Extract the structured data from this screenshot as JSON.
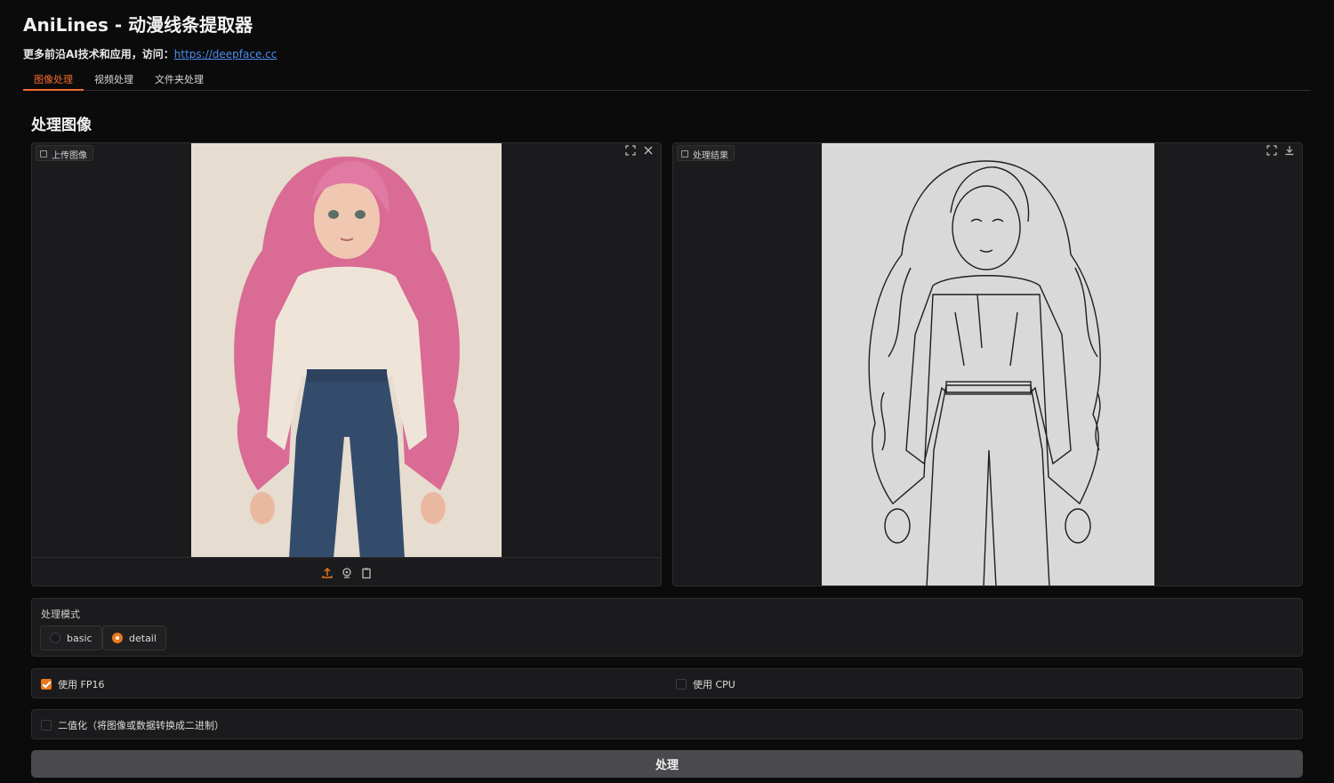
{
  "app": {
    "title": "AniLines - 动漫线条提取器",
    "subtitle_prefix": "更多前沿AI技术和应用，访问：",
    "subtitle_link": "https://deepface.cc"
  },
  "tabs": [
    {
      "label": "图像处理",
      "active": true
    },
    {
      "label": "视频处理",
      "active": false
    },
    {
      "label": "文件夹处理",
      "active": false
    }
  ],
  "section_title": "处理图像",
  "input_panel": {
    "label": "上传图像",
    "icons": [
      "fullscreen-icon",
      "close-icon"
    ],
    "bottom_icons": [
      "upload-icon",
      "webcam-icon",
      "clipboard-icon"
    ]
  },
  "output_panel": {
    "label": "处理结果",
    "icons": [
      "fullscreen-icon",
      "download-icon"
    ]
  },
  "mode": {
    "label": "处理模式",
    "options": [
      {
        "label": "basic",
        "selected": false
      },
      {
        "label": "detail",
        "selected": true
      }
    ]
  },
  "options": {
    "fp16": {
      "label": "使用 FP16",
      "checked": true
    },
    "cpu": {
      "label": "使用 CPU",
      "checked": false
    },
    "binarize": {
      "label": "二值化（将图像或数据转换成二进制）",
      "checked": false
    }
  },
  "submit_label": "处理",
  "colors": {
    "accent": "#f06a30",
    "link": "#4d8df0",
    "background": "#0b0b0c",
    "panel": "#1b1b1d"
  }
}
